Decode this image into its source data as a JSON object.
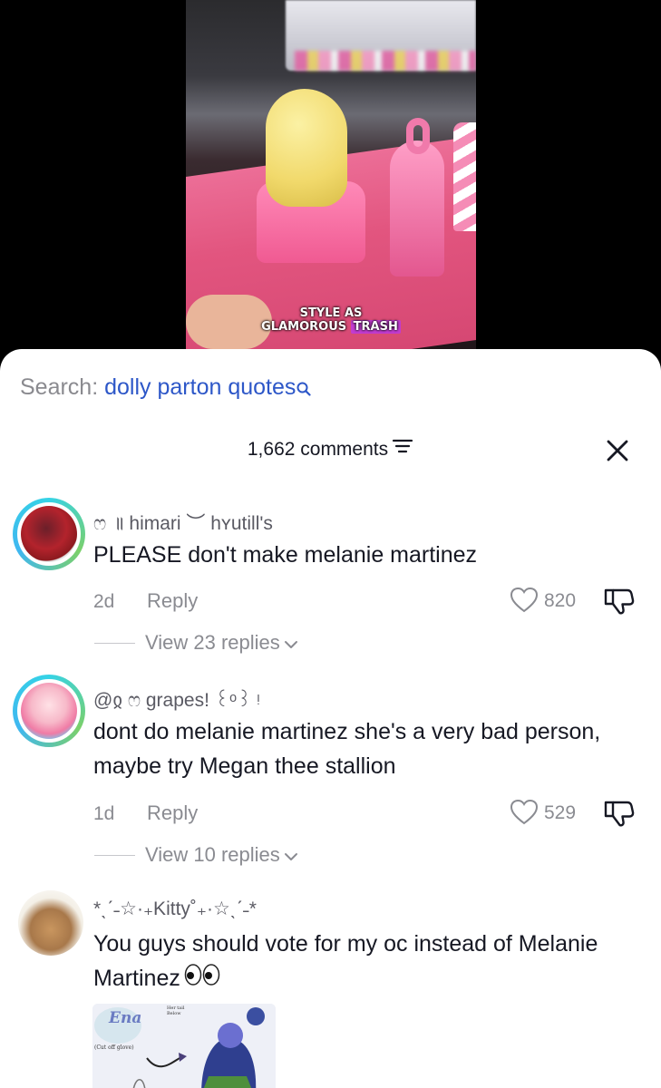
{
  "video": {
    "caption_line1": "STYLE AS",
    "caption_line2_a": "GLAMOROUS",
    "caption_line2_b": "TRASH"
  },
  "search": {
    "prefix": "Search:",
    "query": "dolly parton quotes"
  },
  "header": {
    "comments_count": "1,662 comments"
  },
  "comments": [
    {
      "username": "ෆ ॥ himari ︶ hʏutill's",
      "text": "PLEASE don't make melanie martinez",
      "time": "2d",
      "reply_label": "Reply",
      "likes": "820",
      "view_replies": "View 23 replies"
    },
    {
      "username": "@ჲ ෆ grapes! ꒰ᵒ꒱ ᵎ",
      "text": "dont do melanie martinez she's a very bad person, maybe try Megan thee stallion",
      "time": "1d",
      "reply_label": "Reply",
      "likes": "529",
      "view_replies": "View 10 replies"
    },
    {
      "username": "*ˎˊ˗☆·₊Kitty˚₊·☆ˎˊ˗*",
      "text": "You guys should vote for my oc instead of Melanie Martinez",
      "attachment_texts": [
        "Ena",
        "Her tail Below",
        "(Cut off glove)"
      ]
    }
  ],
  "colors": {
    "accent_blue": "#2d57c8",
    "avatar_ring": "#35d3e6",
    "caption_highlight": "#c23bd0"
  }
}
